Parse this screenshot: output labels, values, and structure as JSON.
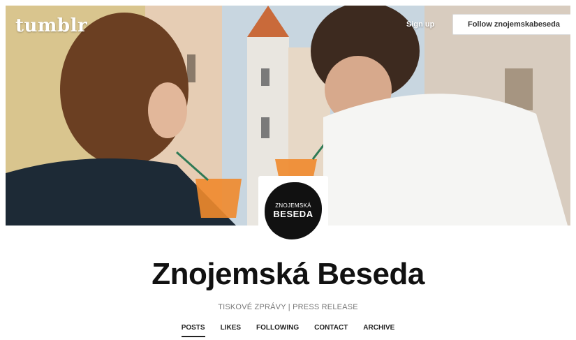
{
  "brand": {
    "logo_text": "tumblr"
  },
  "topbar": {
    "signup_label": "Sign up",
    "follow_label": "Follow znojemskabeseda"
  },
  "avatar": {
    "line1": "ZNOJEMSKÁ",
    "line2": "BESEDA"
  },
  "blog": {
    "title": "Znojemská Beseda",
    "description": "TISKOVÉ ZPRÁVY | PRESS RELEASE"
  },
  "nav": {
    "items": [
      {
        "label": "POSTS"
      },
      {
        "label": "LIKES"
      },
      {
        "label": "FOLLOWING"
      },
      {
        "label": "CONTACT"
      },
      {
        "label": "ARCHIVE"
      }
    ],
    "active_index": 0
  },
  "colors": {
    "accent": "#222222",
    "button_bg": "#ffffff",
    "avatar_bg": "#111111"
  }
}
